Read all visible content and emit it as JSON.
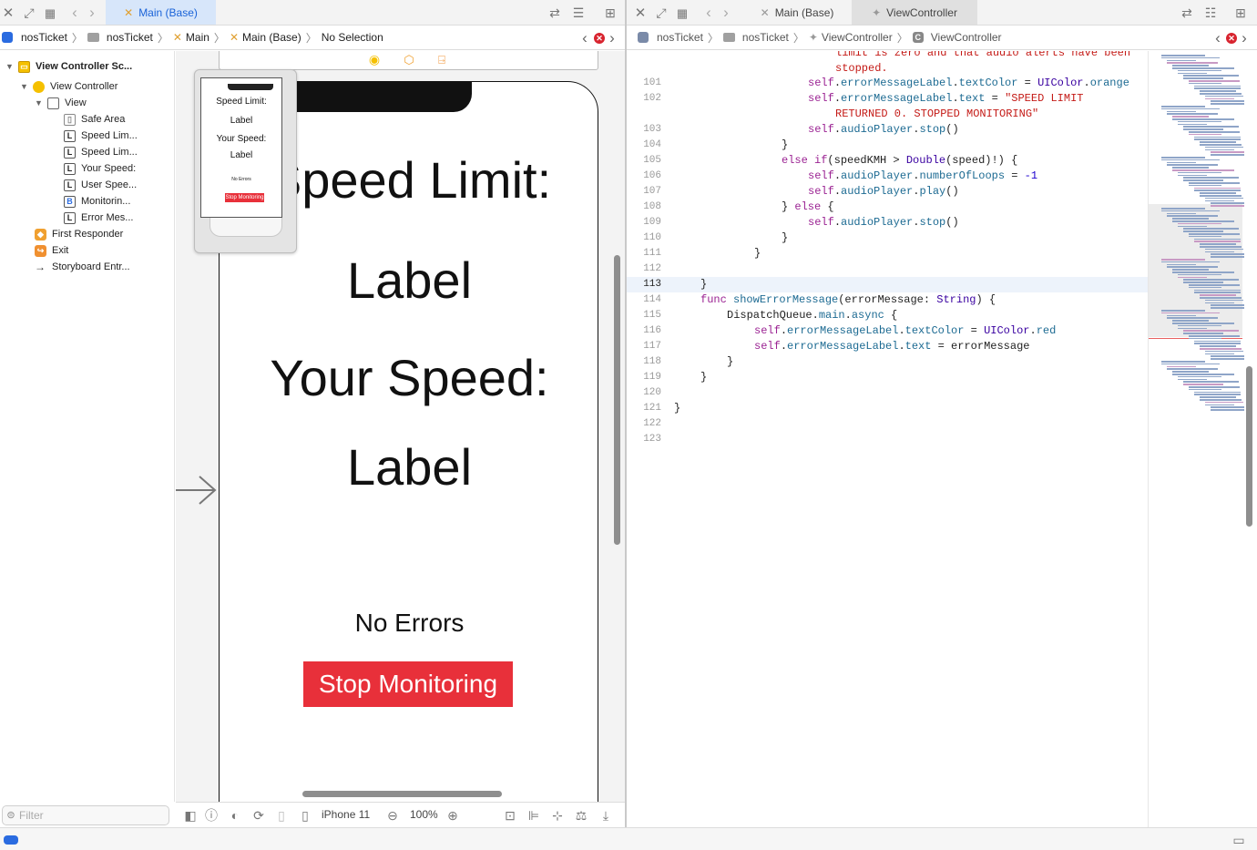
{
  "left_editor": {
    "tab_label": "Main (Base)",
    "jump_bar": [
      "nosTicket",
      "nosTicket",
      "Main",
      "Main (Base)",
      "No Selection"
    ],
    "outline": [
      {
        "label": "View Controller Sc...",
        "badge": "scene",
        "level": 0,
        "expanded": true,
        "bold": true
      },
      {
        "label": "View Controller",
        "badge": "vc",
        "level": 1,
        "expanded": true
      },
      {
        "label": "View",
        "badge": "view",
        "level": 2,
        "expanded": true
      },
      {
        "label": "Safe Area",
        "badge": "safe",
        "level": 3
      },
      {
        "label": "Speed Lim...",
        "badge": "L",
        "level": 3
      },
      {
        "label": "Speed Lim...",
        "badge": "L",
        "level": 3
      },
      {
        "label": "Your Speed:",
        "badge": "L",
        "level": 3
      },
      {
        "label": "User Spee...",
        "badge": "L",
        "level": 3
      },
      {
        "label": "Monitorin...",
        "badge": "B",
        "level": 3
      },
      {
        "label": "Error Mes...",
        "badge": "L",
        "level": 3
      },
      {
        "label": "First Responder",
        "badge": "fr",
        "level": 1
      },
      {
        "label": "Exit",
        "badge": "exit",
        "level": 1
      },
      {
        "label": "Storyboard Entr...",
        "badge": "arrow",
        "level": 1
      }
    ],
    "filter_placeholder": "Filter",
    "canvas": {
      "speed_limit_text": "Speed Limit:",
      "label1": "Label",
      "your_speed_text": "Your Speed:",
      "label2": "Label",
      "no_errors": "No Errors",
      "stop_button": "Stop Monitoring",
      "stop_button_color": "#e8303a"
    },
    "minimap": {
      "speed_limit": "Speed Limit:",
      "label1": "Label",
      "your_speed": "Your Speed:",
      "label2": "Label",
      "no_errors": "No Errors",
      "button": "Stop Monitoring"
    },
    "bottom_bar": {
      "device": "iPhone 11",
      "zoom": "100%"
    }
  },
  "right_editor": {
    "tabs": [
      "Main (Base)",
      "ViewController"
    ],
    "jump_bar": [
      "nosTicket",
      "nosTicket",
      "ViewController",
      "ViewController"
    ],
    "current_line": 113,
    "code_lines": [
      {
        "n": "",
        "text": "limit is zero and that audio alerts have been"
      },
      {
        "n": "",
        "text": "stopped."
      },
      {
        "n": "101",
        "text": "self.errorMessageLabel.textColor = UIColor.orange"
      },
      {
        "n": "102",
        "text": "self.errorMessageLabel.text = \"SPEED LIMIT"
      },
      {
        "n": "",
        "text": "RETURNED 0. STOPPED MONITORING\""
      },
      {
        "n": "103",
        "text": "self.audioPlayer.stop()"
      },
      {
        "n": "104",
        "text": "}"
      },
      {
        "n": "105",
        "text": "else if(speedKMH > Double(speed)!) {"
      },
      {
        "n": "106",
        "text": "self.audioPlayer.numberOfLoops = -1"
      },
      {
        "n": "107",
        "text": "self.audioPlayer.play()"
      },
      {
        "n": "108",
        "text": "} else {"
      },
      {
        "n": "109",
        "text": "self.audioPlayer.stop()"
      },
      {
        "n": "110",
        "text": "}"
      },
      {
        "n": "111",
        "text": "}"
      },
      {
        "n": "112",
        "text": ""
      },
      {
        "n": "113",
        "text": "}"
      },
      {
        "n": "114",
        "text": "func showErrorMessage(errorMessage: String) {"
      },
      {
        "n": "115",
        "text": "DispatchQueue.main.async {"
      },
      {
        "n": "116",
        "text": "self.errorMessageLabel.textColor = UIColor.red"
      },
      {
        "n": "117",
        "text": "self.errorMessageLabel.text = errorMessage"
      },
      {
        "n": "118",
        "text": "}"
      },
      {
        "n": "119",
        "text": "}"
      },
      {
        "n": "120",
        "text": ""
      },
      {
        "n": "121",
        "text": "}"
      },
      {
        "n": "122",
        "text": ""
      },
      {
        "n": "123",
        "text": ""
      }
    ]
  },
  "colors": {
    "accent": "#2a6be0",
    "keyword": "#9b2393",
    "string": "#c41a16",
    "error": "#d8242f"
  }
}
